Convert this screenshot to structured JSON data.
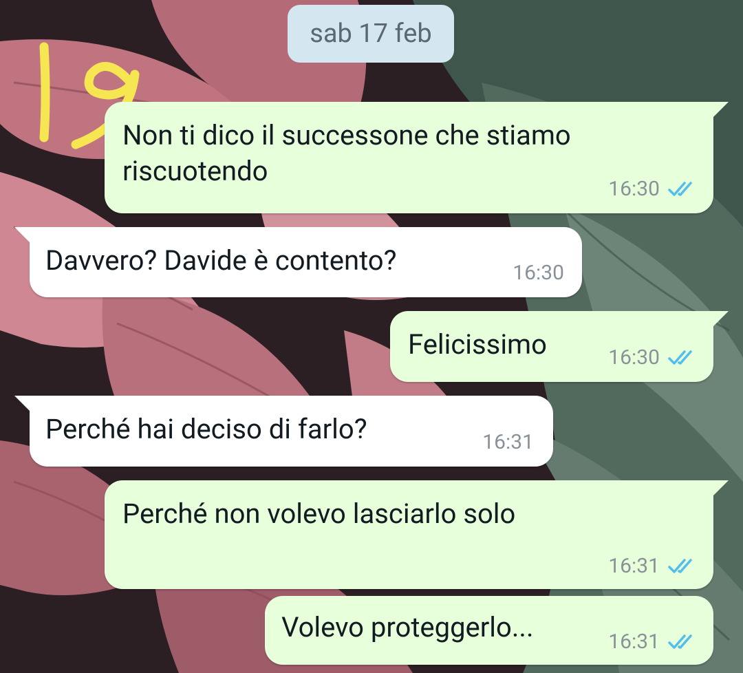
{
  "date_chip": "sab 17 feb",
  "annotation": "19",
  "messages": [
    {
      "direction": "out",
      "text": "Non ti dico il successone che stiamo\nriscuotendo",
      "time": "16:30",
      "status": "read"
    },
    {
      "direction": "in",
      "text": "Davvero? Davide è contento?",
      "time": "16:30"
    },
    {
      "direction": "out",
      "text": "Felicissimo",
      "time": "16:30",
      "status": "read"
    },
    {
      "direction": "in",
      "text": "Perché hai deciso di farlo?",
      "time": "16:31"
    },
    {
      "direction": "out",
      "text": "Perché non volevo lasciarlo solo",
      "time": "16:31",
      "status": "read"
    },
    {
      "direction": "out",
      "text": "Volevo proteggerlo...",
      "time": "16:31",
      "status": "read"
    }
  ],
  "colors": {
    "outgoing_bubble": "#e7ffdb",
    "incoming_bubble": "#ffffff",
    "date_chip": "#d4e6ef",
    "read_ticks": "#53bdeb",
    "annotation": "#f6e651"
  }
}
